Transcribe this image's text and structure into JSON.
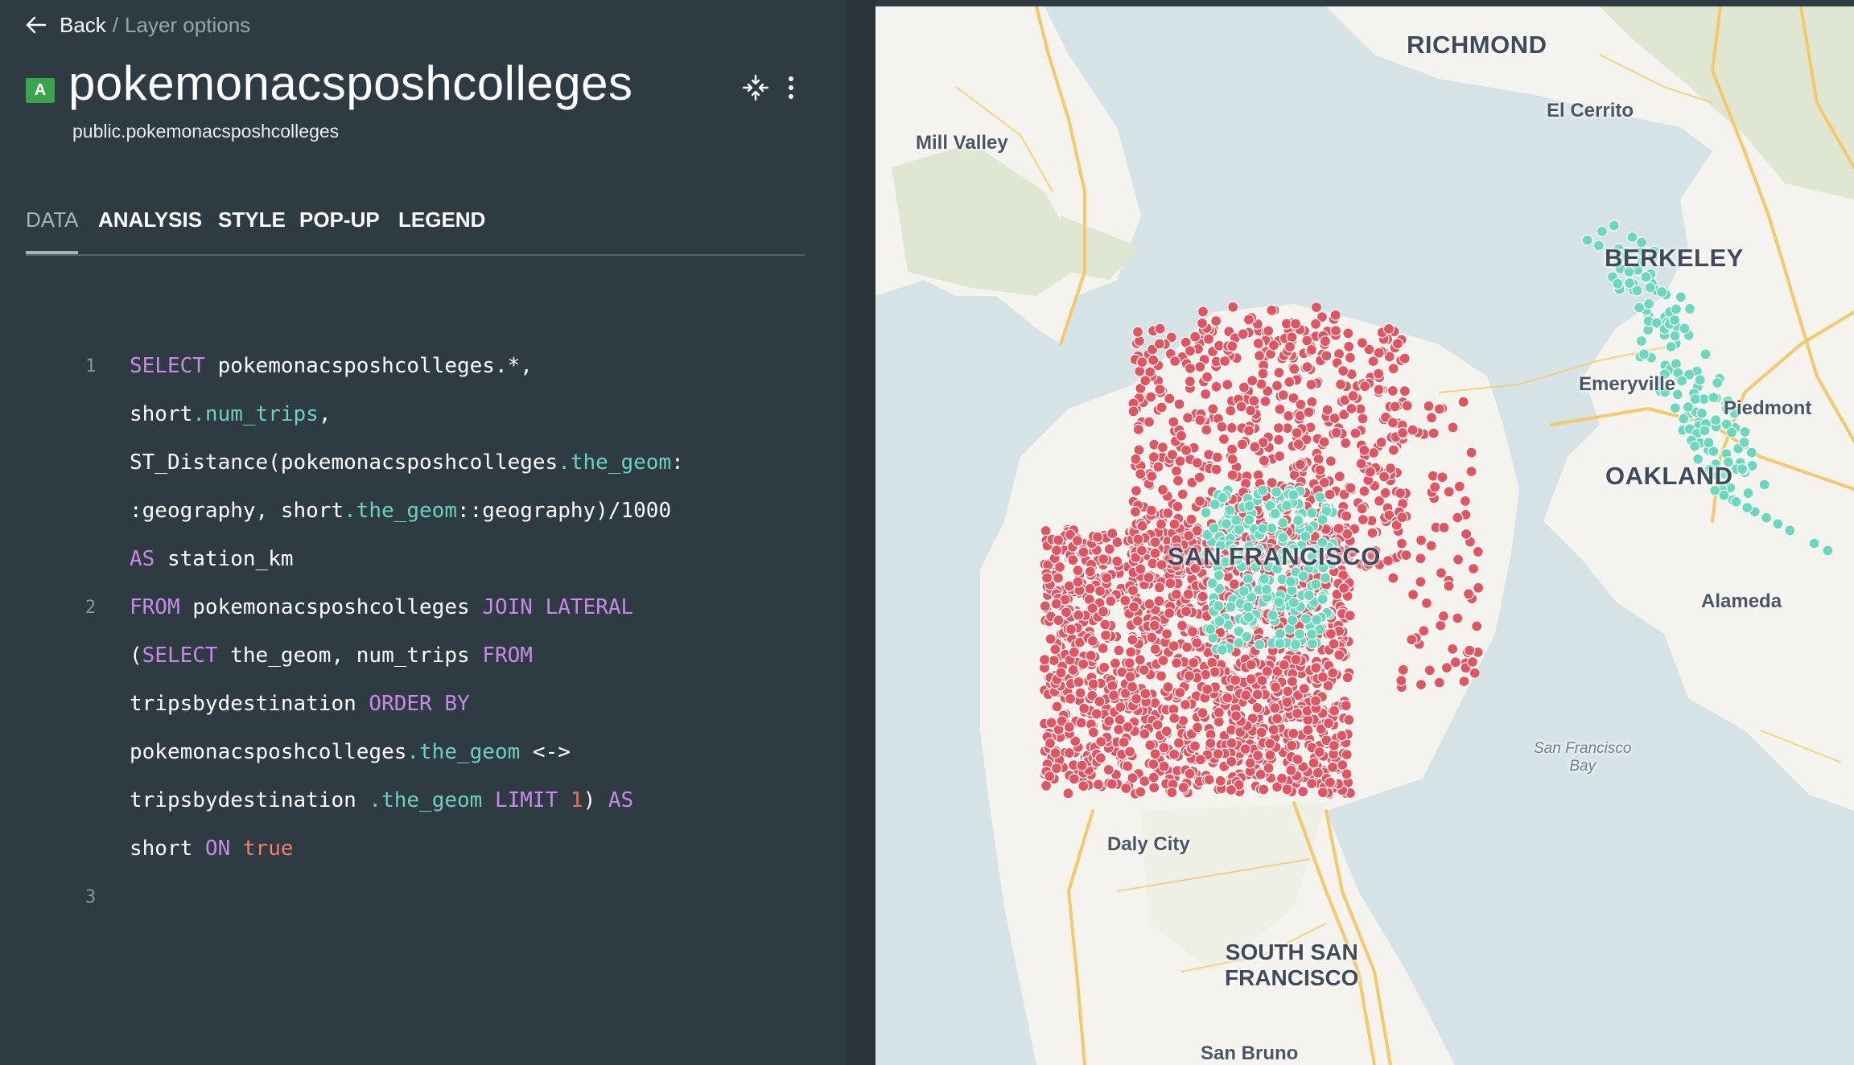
{
  "nav": {
    "back_label": "Back",
    "separator": "/",
    "crumb": "Layer options"
  },
  "layer": {
    "badge": "A",
    "title": "pokemonacsposhcolleges",
    "subtitle": "public.pokemonacsposhcolleges"
  },
  "tabs": [
    {
      "label": "DATA",
      "active": true
    },
    {
      "label": "ANALYSIS",
      "active": false
    },
    {
      "label": "STYLE",
      "active": false
    },
    {
      "label": "POP-UP",
      "active": false
    },
    {
      "label": "LEGEND",
      "active": false
    }
  ],
  "code": {
    "line_numbers": [
      "1",
      "2",
      "3"
    ],
    "lines": [
      [
        {
          "t": "SELECT",
          "c": "kw"
        },
        {
          "t": " pokemonacsposhcolleges.*,",
          "c": ""
        }
      ],
      [
        {
          "t": "short",
          "c": ""
        },
        {
          "t": ".num_trips",
          "c": "prop"
        },
        {
          "t": ",",
          "c": ""
        }
      ],
      [
        {
          "t": "ST_Distance(pokemonacsposhcolleges",
          "c": ""
        },
        {
          "t": ".the_geom",
          "c": "prop"
        },
        {
          "t": ":",
          "c": ""
        }
      ],
      [
        {
          "t": ":geography, short",
          "c": ""
        },
        {
          "t": ".the_geom",
          "c": "prop"
        },
        {
          "t": "::geography)/1000",
          "c": ""
        }
      ],
      [
        {
          "t": "AS",
          "c": "kw"
        },
        {
          "t": " station_km",
          "c": ""
        }
      ],
      [
        {
          "t": "FROM",
          "c": "kw"
        },
        {
          "t": " pokemonacsposhcolleges ",
          "c": ""
        },
        {
          "t": "JOIN LATERAL",
          "c": "kw"
        }
      ],
      [
        {
          "t": "(",
          "c": ""
        },
        {
          "t": "SELECT",
          "c": "kw"
        },
        {
          "t": " the_geom, num_trips ",
          "c": ""
        },
        {
          "t": "FROM",
          "c": "kw"
        }
      ],
      [
        {
          "t": "tripsbydestination ",
          "c": ""
        },
        {
          "t": "ORDER BY",
          "c": "kw"
        }
      ],
      [
        {
          "t": "pokemonacsposhcolleges",
          "c": ""
        },
        {
          "t": ".the_geom",
          "c": "prop"
        },
        {
          "t": " <->",
          "c": ""
        }
      ],
      [
        {
          "t": "tripsbydestination ",
          "c": ""
        },
        {
          "t": ".the_geom",
          "c": "prop"
        },
        {
          "t": " ",
          "c": ""
        },
        {
          "t": "LIMIT",
          "c": "kw"
        },
        {
          "t": " ",
          "c": ""
        },
        {
          "t": "1",
          "c": "num"
        },
        {
          "t": ") ",
          "c": ""
        },
        {
          "t": "AS",
          "c": "kw"
        }
      ],
      [
        {
          "t": "short ",
          "c": ""
        },
        {
          "t": "ON",
          "c": "kw"
        },
        {
          "t": " ",
          "c": ""
        },
        {
          "t": "true",
          "c": "bool"
        }
      ]
    ]
  },
  "map": {
    "labels": {
      "richmond": "RICHMOND",
      "el_cerrito": "El Cerrito",
      "mill_valley": "Mill Valley",
      "berkeley": "BERKELEY",
      "emeryville": "Emeryville",
      "piedmont": "Piedmont",
      "oakland": "OAKLAND",
      "san_francisco": "SAN FRANCISCO",
      "alameda": "Alameda",
      "sf_bay_1": "San Francisco",
      "sf_bay_2": "Bay",
      "daly_city": "Daly City",
      "south_sf_1": "SOUTH SAN",
      "south_sf_2": "FRANCISCO",
      "san_bruno": "San Bruno"
    },
    "colors": {
      "water": "#d6e3e6",
      "land": "#f5f3ee",
      "park": "#dfe6d2",
      "road": "#f4c969",
      "points_red": "#e25560",
      "points_green": "#69d8bb"
    }
  }
}
